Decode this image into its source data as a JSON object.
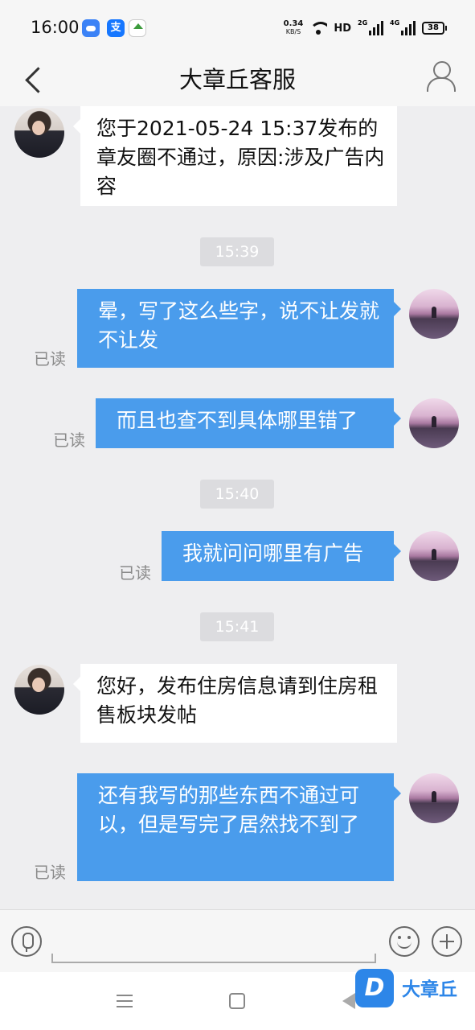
{
  "status_bar": {
    "time": "16:00",
    "net_speed_value": "0.34",
    "net_speed_unit": "KB/S",
    "hd_label": "HD",
    "sim1_label": "2G",
    "sim2_label": "4G",
    "battery": "38",
    "app_icons": [
      "cloud-icon",
      "alipay-icon",
      "home-app-icon"
    ]
  },
  "header": {
    "title": "大章丘客服"
  },
  "messages": [
    {
      "side": "in",
      "text": "您于2021-05-24 15:37发布的章友圈不通过，原因:涉及广告内容"
    },
    {
      "timestamp": "15:39"
    },
    {
      "side": "out",
      "text": "晕，写了这么些字，说不让发就不让发",
      "read": "已读"
    },
    {
      "side": "out",
      "text": "而且也查不到具体哪里错了",
      "read": "已读"
    },
    {
      "timestamp": "15:40"
    },
    {
      "side": "out",
      "text": "我就问问哪里有广告",
      "read": "已读"
    },
    {
      "timestamp": "15:41"
    },
    {
      "side": "in",
      "text": "您好，发布住房信息请到住房租售板块发帖"
    },
    {
      "side": "out",
      "text": "还有我写的那些东西不通过可以，但是写完了居然找不到了",
      "read": "已读"
    }
  ],
  "watermark": {
    "logo_letter": "D",
    "text": "大章丘"
  },
  "colors": {
    "outgoing_bubble": "#4a9cec",
    "incoming_bubble": "#ffffff",
    "chat_background": "#eeeef0",
    "brand": "#2d86e8"
  }
}
